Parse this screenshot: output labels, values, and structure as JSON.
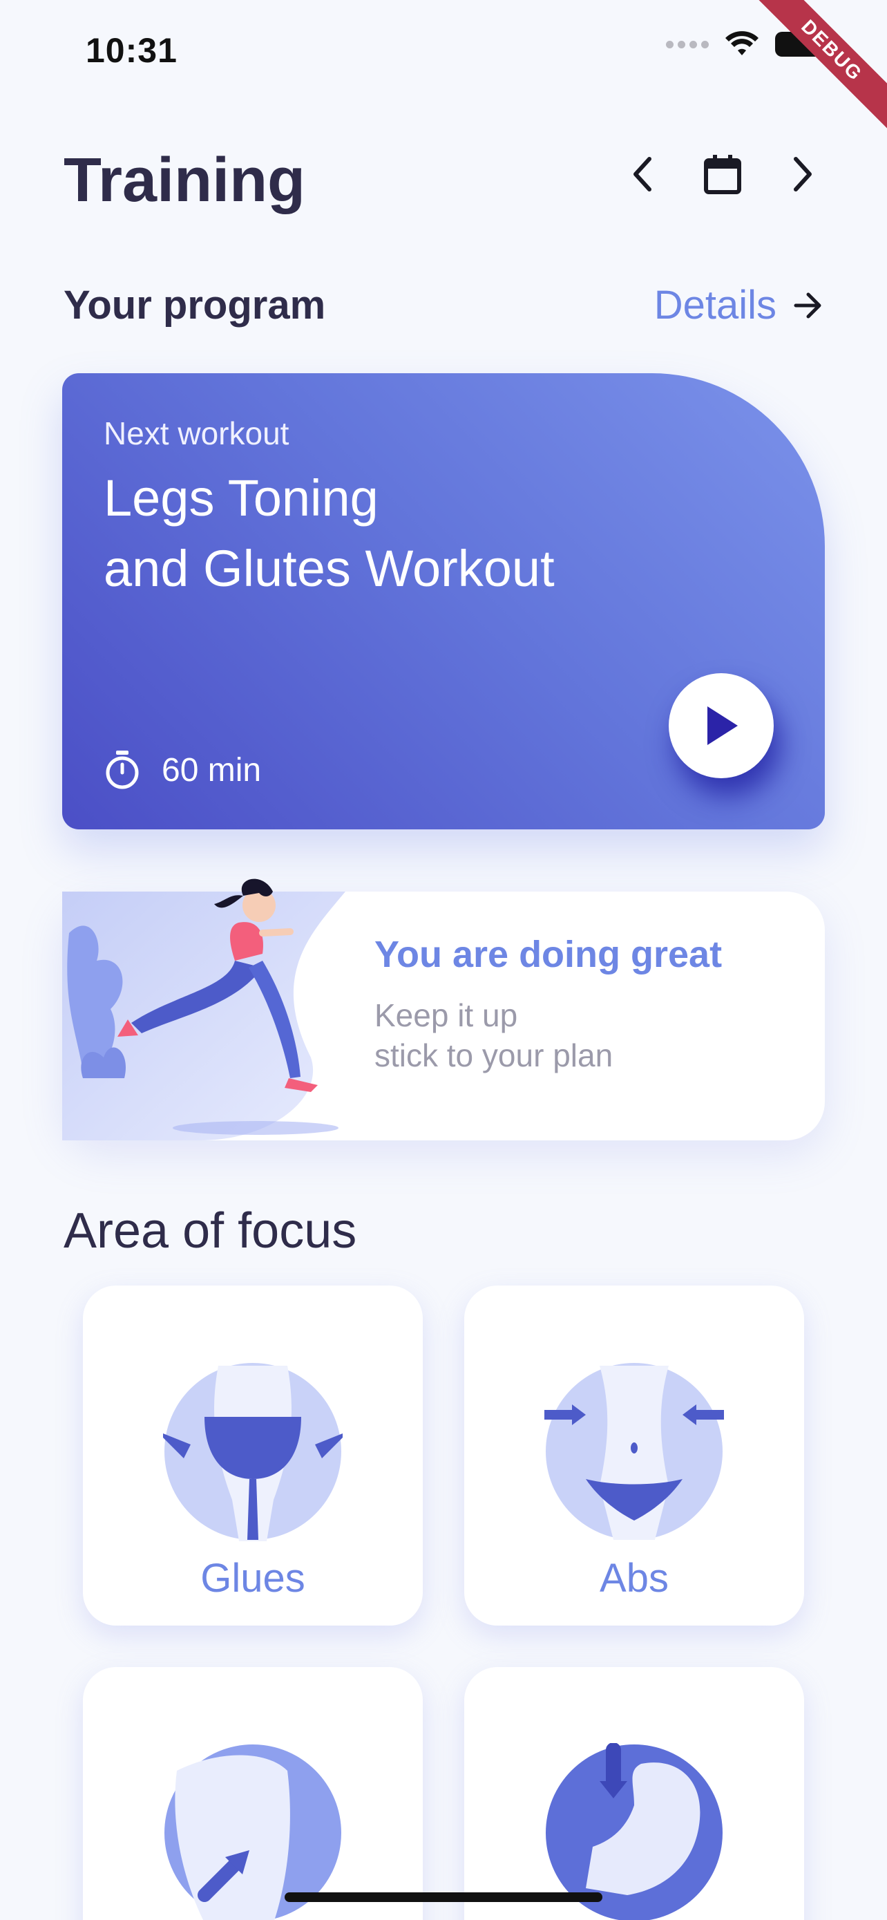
{
  "status_bar": {
    "time": "10:31"
  },
  "debug_banner": "DEBUG",
  "header": {
    "title": "Training"
  },
  "program": {
    "section_title": "Your program",
    "details_label": "Details"
  },
  "workout": {
    "label": "Next workout",
    "title_line1": "Legs Toning",
    "title_line2": "and Glutes Workout",
    "duration": "60 min"
  },
  "encouragement": {
    "title": "You are doing great",
    "line1": "Keep it up",
    "line2": "stick to your plan"
  },
  "focus": {
    "section_title": "Area of focus",
    "items": [
      {
        "label": "Glues",
        "icon": "glutes-icon"
      },
      {
        "label": "Abs",
        "icon": "abs-icon"
      },
      {
        "label": "",
        "icon": "back-icon"
      },
      {
        "label": "",
        "icon": "biceps-icon"
      }
    ]
  },
  "colors": {
    "accent": "#6d86e4",
    "card_gradient_start": "#4b4fc6",
    "card_gradient_end": "#7b92ea",
    "play_icon": "#2b23a8",
    "text_dark": "#2f2c4a",
    "text_muted": "#9b9aaa"
  }
}
